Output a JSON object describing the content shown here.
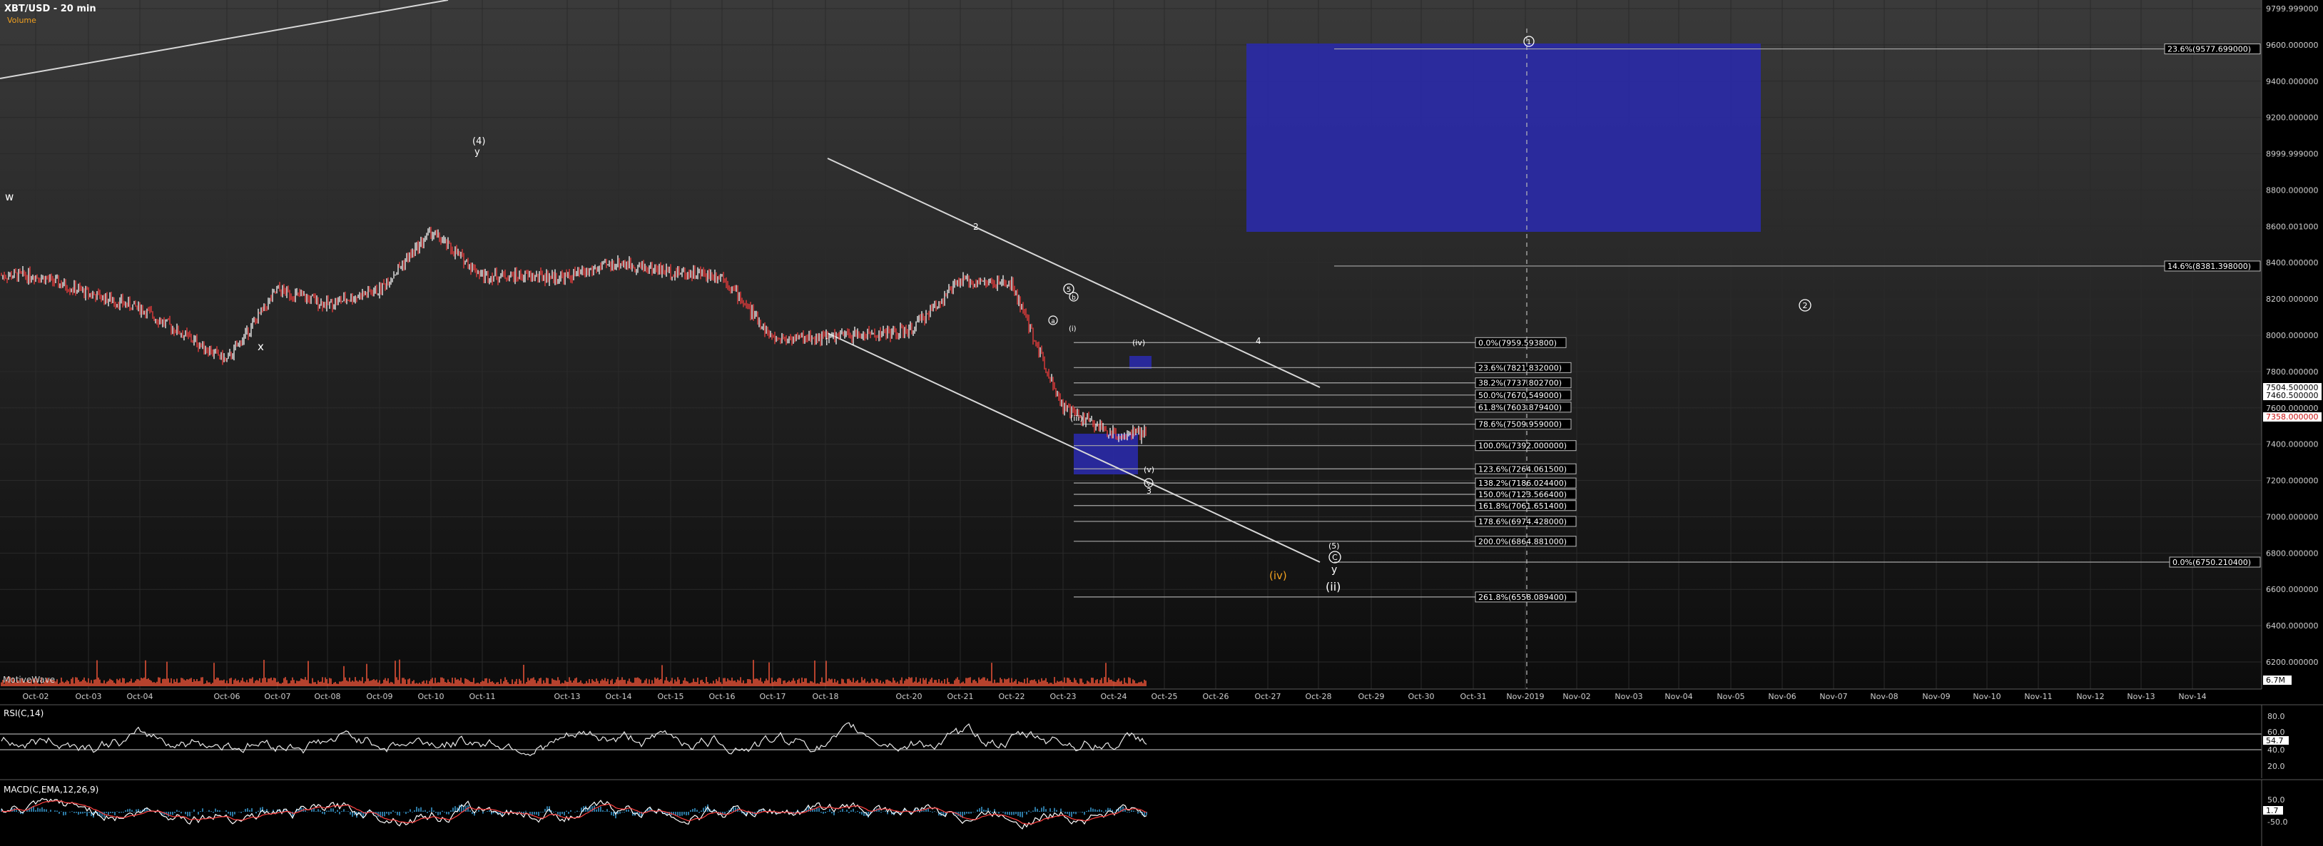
{
  "header": {
    "title": "XBT/USD - 20 min",
    "subtitle": "Volume",
    "watermark": "MotiveWave"
  },
  "colors": {
    "background": "#000000",
    "grid": "#2a2a2a",
    "candle_up": "#e8e8e8",
    "candle_down": "#e23b3b",
    "volume": "#ff5a3c",
    "fib_box": "#2a2aa8",
    "fib_line": "#a8a8a8",
    "trend_line": "#d8d8d8",
    "wave_label": "#ffffff",
    "wave_label_orange": "#f0a020",
    "rsi_line": "#e8e8e8",
    "macd_line": "#ffffff",
    "signal_line": "#ff4040",
    "macd_hist": "#3aa0d8"
  },
  "x_axis": {
    "labels": [
      "Oct-02",
      "Oct-03",
      "Oct-04",
      "Oct-06",
      "Oct-07",
      "Oct-08",
      "Oct-09",
      "Oct-10",
      "Oct-11",
      "Oct-13",
      "Oct-14",
      "Oct-15",
      "Oct-16",
      "Oct-17",
      "Oct-18",
      "Oct-20",
      "Oct-21",
      "Oct-22",
      "Oct-23",
      "Oct-24",
      "Oct-25",
      "Oct-26",
      "Oct-27",
      "Oct-28",
      "Oct-29",
      "Oct-30",
      "Oct-31",
      "Nov-2019",
      "Nov-02",
      "Nov-03",
      "Nov-04",
      "Nov-05",
      "Nov-06",
      "Nov-07",
      "Nov-08",
      "Nov-09",
      "Nov-10",
      "Nov-11",
      "Nov-12",
      "Nov-13",
      "Nov-14"
    ]
  },
  "price_axis": {
    "labels": [
      "9799.999000",
      "9600.000000",
      "9400.000000",
      "9200.000000",
      "8999.999000",
      "8800.000000",
      "8600.001000",
      "8400.000000",
      "8200.000000",
      "8000.000000",
      "7800.000000",
      "7600.000000",
      "7400.000000",
      "7200.000000",
      "7000.000000",
      "6800.000000",
      "6600.000000",
      "6400.000000",
      "6200.000000"
    ],
    "current_price_labels": [
      "7504.500000",
      "7460.500000",
      "7358.000000"
    ],
    "volume_label": "6.7M"
  },
  "fib_levels": [
    {
      "label": "0.0%(7959.593800)"
    },
    {
      "label": "23.6%(7821.832000)"
    },
    {
      "label": "38.2%(7737.802700)"
    },
    {
      "label": "50.0%(7670.549000)"
    },
    {
      "label": "61.8%(7603.879400)"
    },
    {
      "label": "78.6%(7509.959000)"
    },
    {
      "label": "100.0%(7392.000000)"
    },
    {
      "label": "123.6%(7264.061500)"
    },
    {
      "label": "138.2%(7186.024400)"
    },
    {
      "label": "150.0%(7123.566400)"
    },
    {
      "label": "161.8%(7061.651400)"
    },
    {
      "label": "178.6%(6974.428000)"
    },
    {
      "label": "200.0%(6864.881000)"
    },
    {
      "label": "261.8%(6558.089400)"
    }
  ],
  "fib_right": [
    {
      "label": "23.6%(9577.699000)"
    },
    {
      "label": "14.6%(8381.398000)"
    },
    {
      "label": "0.0%(6750.210400)"
    }
  ],
  "wave_labels": {
    "w": "w",
    "x1": "x",
    "four_paren": "(4)",
    "y1": "y",
    "i": "i",
    "two": "2",
    "iv": "(iv)",
    "four": "4",
    "iii": "(iii)",
    "v": "(v)",
    "five_circle": "5",
    "three": "3",
    "iv_orange": "(iv)",
    "five_paren": "(5)",
    "c_circle": "C",
    "y2": "y",
    "ii": "(ii)",
    "one_circle": "1",
    "two_circle": "2",
    "circ_a": "a",
    "circ_b": "b",
    "circ_v": "v",
    "i_paren": "(i)"
  },
  "rsi": {
    "title": "RSI(C,14)",
    "labels": [
      "80.0",
      "60.0",
      "54.7",
      "40.0",
      "20.0"
    ]
  },
  "macd": {
    "title": "MACD(C,EMA,12,26,9)",
    "labels": [
      "50.0",
      "1.7",
      "-50.0"
    ]
  },
  "chart_data": {
    "type": "line",
    "title": "XBT/USD - 20 min",
    "x": [
      "Oct-02",
      "Oct-03",
      "Oct-04",
      "Oct-06",
      "Oct-07",
      "Oct-08",
      "Oct-09",
      "Oct-10",
      "Oct-11",
      "Oct-13",
      "Oct-14",
      "Oct-15",
      "Oct-16",
      "Oct-17",
      "Oct-18",
      "Oct-20",
      "Oct-21",
      "Oct-22",
      "Oct-23",
      "Oct-24"
    ],
    "series": [
      {
        "name": "XBT/USD",
        "values": [
          8330,
          8230,
          8150,
          7860,
          8250,
          8170,
          8250,
          8570,
          8330,
          8320,
          8400,
          8350,
          8330,
          7980,
          7990,
          8020,
          8300,
          8280,
          7600,
          7455
        ]
      }
    ],
    "ylim": [
      6100,
      9850
    ],
    "grid": true
  }
}
